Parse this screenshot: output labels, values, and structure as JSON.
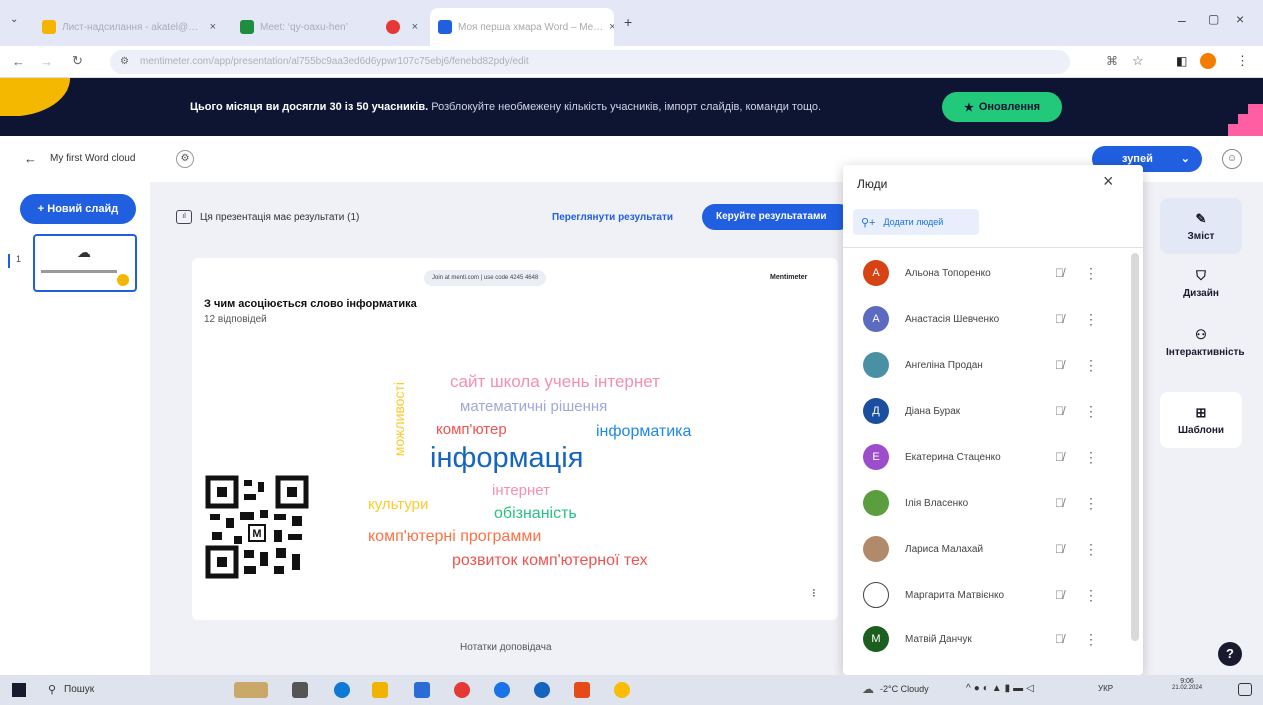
{
  "browser": {
    "tabs": [
      {
        "label": "Лист-надсилання - akatel@…",
        "color": "#f4b400"
      },
      {
        "label": "Meet: ‘qy-oaxu-hen’",
        "color": "#1e8e3e"
      },
      {
        "label": "",
        "color": "#e53935"
      },
      {
        "label": "Моя перша хмара Word – Me…",
        "color": "#1f5fe0"
      }
    ],
    "url": "mentimeter.com/app/presentation/al755bc9aa3ed6d6ypwr107c75ebj6/fenebd82pdy/edit"
  },
  "banner": {
    "message_bold": "Цього місяця ви досягли 30 із 50 учасників.",
    "message_rest": "Розблокуйте необмежену кількість учасників, імпорт слайдів, команди тощо.",
    "upgrade_label": "Оновлення"
  },
  "app": {
    "title": "My first Word cloud",
    "present_label": "зупей"
  },
  "left_rail": {
    "new_slide_label": "+ Новий слайд",
    "slide_number": "1"
  },
  "results_bar": {
    "info_text": "Ця презентація має результати (1)",
    "view_results_label": "Переглянути результати",
    "manage_results_label": "Керуйте результатами"
  },
  "slide": {
    "join_text": "Join at menti.com | use code 4245 4648",
    "brand": "Mentimeter",
    "question": "З чим асоціюється слово інформатика",
    "responses": "12 відповідей",
    "words": [
      {
        "text": "сайт школа учень інтернет",
        "color": "#f48fb1"
      },
      {
        "text": "математичні рішення",
        "color": "#9fa8da"
      },
      {
        "text": "комп'ютер",
        "color": "#ef5350"
      },
      {
        "text": "інформатика",
        "color": "#1e88e5"
      },
      {
        "text": "інформація",
        "color": "#1565c0"
      },
      {
        "text": "інтернет",
        "color": "#f48fb1"
      },
      {
        "text": "культури",
        "color": "#ffca28"
      },
      {
        "text": "обізнаність",
        "color": "#26c281"
      },
      {
        "text": "комп'ютерні программи",
        "color": "#ff7043"
      },
      {
        "text": "розвиток комп'ютерної тех",
        "color": "#ef5350"
      },
      {
        "text": "можливості",
        "color": "#ffca28"
      }
    ],
    "notes_label": "Нотатки доповідача"
  },
  "right_rail": {
    "content_label": "Зміст",
    "design_label": "Дизайн",
    "interactivity_label": "Інтерактивність",
    "templates_label": "Шаблони"
  },
  "people_panel": {
    "title": "Люди",
    "add_people_label": "Додати людей",
    "people": [
      {
        "initial": "А",
        "name": "Альона Топоренко",
        "color": "#d84315"
      },
      {
        "initial": "А",
        "name": "Анастасія Шевченко",
        "color": "#5c6bc0"
      },
      {
        "initial": "",
        "name": "Ангеліна Продан",
        "color": "#4a90a4"
      },
      {
        "initial": "Д",
        "name": "Діана Бурак",
        "color": "#1a4fa0"
      },
      {
        "initial": "Е",
        "name": "Екатерина Стаценко",
        "color": "#9c4dcc"
      },
      {
        "initial": "",
        "name": "Ілія Власенко",
        "color": "#5a9e3d"
      },
      {
        "initial": "",
        "name": "Лариса Малахай",
        "color": "#b08a6a"
      },
      {
        "initial": "",
        "name": "Маргарита Матвієнко",
        "color": "#ffffff"
      },
      {
        "initial": "М",
        "name": "Матвій Данчук",
        "color": "#1b5e20"
      }
    ]
  },
  "taskbar": {
    "search_label": "Пошук",
    "weather": "-2°C Cloudy",
    "time": "9:06",
    "date": "21.02.2024",
    "lang": "УКР"
  }
}
